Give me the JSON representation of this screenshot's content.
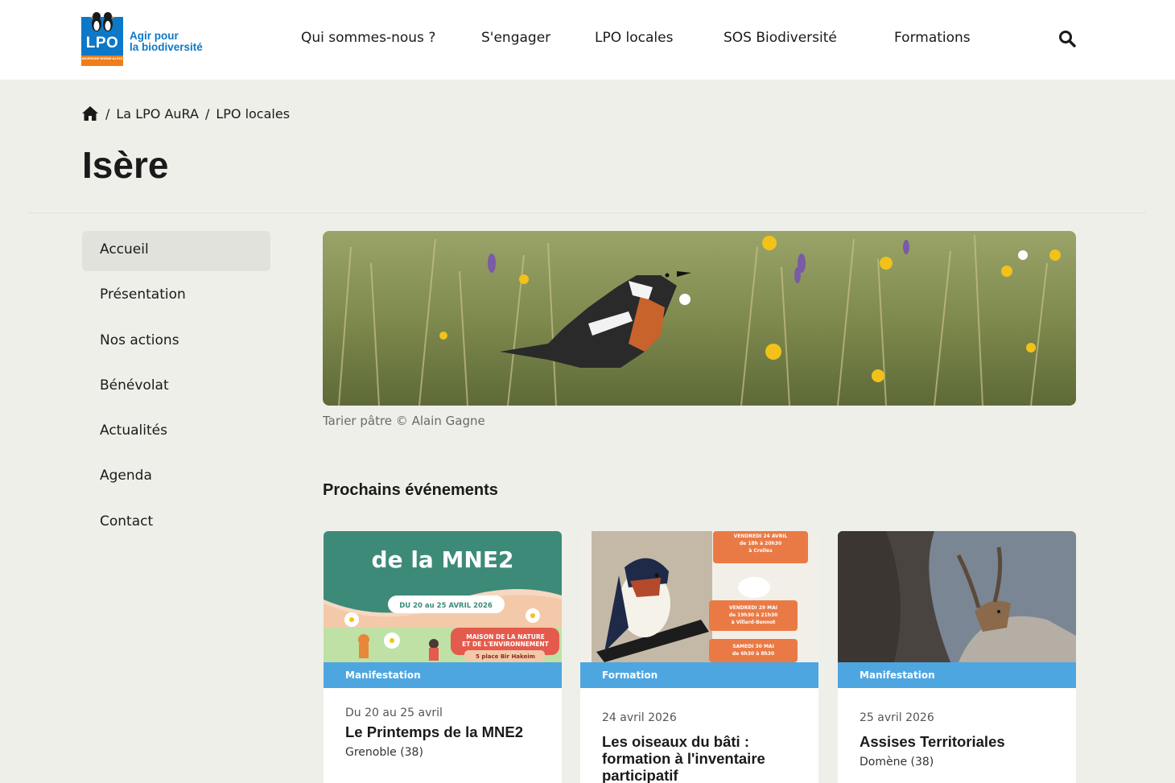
{
  "header": {
    "logo": {
      "brand": "LPO",
      "tagline_line1": "Agir pour",
      "tagline_line2": "la biodiversité",
      "region": "AUVERGNE RHÔNE-ALPES"
    },
    "nav": [
      {
        "label": "Qui sommes-nous ?"
      },
      {
        "label": "S'engager"
      },
      {
        "label": "LPO locales"
      },
      {
        "label": "SOS Biodiversité"
      },
      {
        "label": "Formations"
      }
    ],
    "search_icon": "search-icon"
  },
  "breadcrumb": {
    "home_icon": "home-icon",
    "sep": "/",
    "items": [
      "La LPO AuRA",
      "LPO locales"
    ]
  },
  "page": {
    "title": "Isère"
  },
  "sidebar": {
    "items": [
      {
        "label": "Accueil",
        "active": true
      },
      {
        "label": "Présentation"
      },
      {
        "label": "Nos actions"
      },
      {
        "label": "Bénévolat"
      },
      {
        "label": "Actualités"
      },
      {
        "label": "Agenda"
      },
      {
        "label": "Contact"
      }
    ]
  },
  "hero": {
    "caption": "Tarier pâtre © Alain Gagne"
  },
  "events": {
    "title": "Prochains événements",
    "cards": [
      {
        "tag": "Manifestation",
        "date": "Du 20 au 25 avril",
        "title": "Le Printemps de la MNE2",
        "place": "Grenoble (38)",
        "poster": {
          "headline": "de la MNE2",
          "dates": "DU 20 au 25 AVRIL 2026",
          "venue1": "MAISON DE LA NATURE",
          "venue2": "ET DE L'ENVIRONNEMENT",
          "address": "5 place Bir Hakeim"
        }
      },
      {
        "tag": "Formation",
        "date": "24 avril 2026",
        "title": "Les oiseaux du bâti : formation à l'inventaire participatif",
        "place": "",
        "poster": {
          "b1l1": "VENDREDI 24 AVRIL",
          "b1l2": "de 18h à 20h30",
          "b1l3": "à Crolles",
          "b2l1": "VENDREDI 29 MAI",
          "b2l2": "de 19h30 à 21h30",
          "b2l3": "à Villard-Bonnot",
          "b3l1": "SAMEDI 30 MAI",
          "b3l2": "de 6h30 à 8h30"
        }
      },
      {
        "tag": "Manifestation",
        "date": "25 avril 2026",
        "title": "Assises Territoriales",
        "place": "Domène (38)"
      }
    ]
  },
  "colors": {
    "accent_blue": "#4ea6e0",
    "logo_blue": "#0d78c8",
    "logo_orange": "#f07d1b",
    "page_bg": "#efefe9"
  }
}
